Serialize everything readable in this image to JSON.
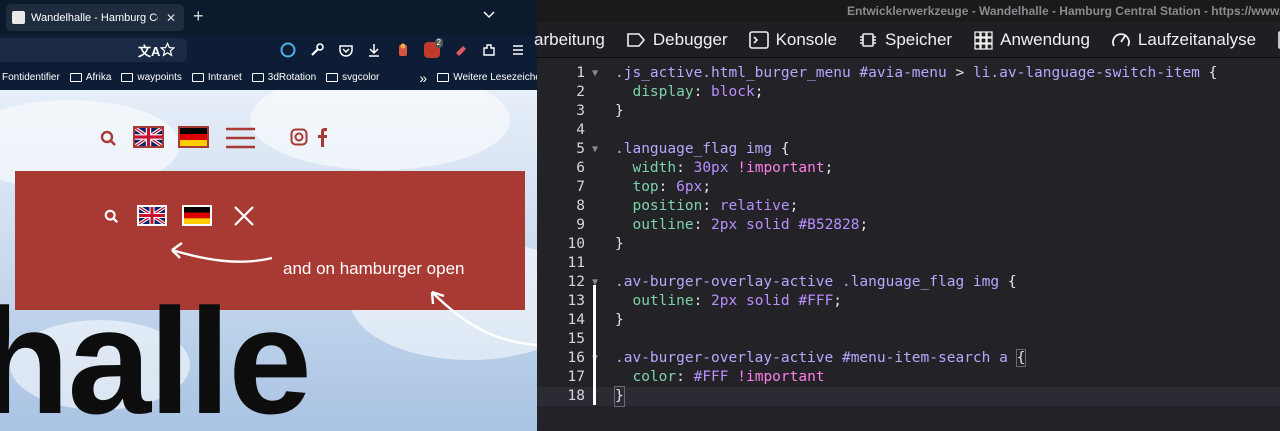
{
  "browser": {
    "tab_title": "Wandelhalle - Hamburg Central",
    "new_tab": "+",
    "bookmarks": [
      "Fontidentifier",
      "Afrika",
      "waypoints",
      "Intranet",
      "3dRotation",
      "svgcolor"
    ],
    "bookmarks_more": "»",
    "bookmarks_other": "Weitere Lesezeichen",
    "extension_badge": "2"
  },
  "webpage": {
    "hero_text": "halle",
    "annotation": "and on hamburger open"
  },
  "devtools": {
    "title": "Entwicklerwerkzeuge - Wandelhalle - Hamburg Central Station - https://www.wandel",
    "tabs": [
      "arbeitung",
      "Debugger",
      "Konsole",
      "Speicher",
      "Anwendung",
      "Laufzeitanalyse",
      "W"
    ],
    "lines": [
      {
        "n": "1",
        "fold": true,
        "text": ".js_active.html_burger_menu #avia-menu > li.av-language-switch-item {"
      },
      {
        "n": "2",
        "text": "  display: block;"
      },
      {
        "n": "3",
        "text": "}"
      },
      {
        "n": "4",
        "text": ""
      },
      {
        "n": "5",
        "fold": true,
        "text": ".language_flag img {"
      },
      {
        "n": "6",
        "text": "  width: 30px !important;"
      },
      {
        "n": "7",
        "text": "  top: 6px;"
      },
      {
        "n": "8",
        "text": "  position: relative;"
      },
      {
        "n": "9",
        "text": "  outline: 2px solid #B52828;"
      },
      {
        "n": "10",
        "text": "}"
      },
      {
        "n": "11",
        "text": ""
      },
      {
        "n": "12",
        "fold": true,
        "text": ".av-burger-overlay-active .language_flag img {"
      },
      {
        "n": "13",
        "text": "  outline: 2px solid #FFF;"
      },
      {
        "n": "14",
        "text": "}"
      },
      {
        "n": "15",
        "text": ""
      },
      {
        "n": "16",
        "fold": true,
        "text": ".av-burger-overlay-active #menu-item-search a {"
      },
      {
        "n": "17",
        "text": "  color: #FFF !important"
      },
      {
        "n": "18",
        "text": "}"
      }
    ]
  },
  "colors": {
    "accent_red": "#a83a33",
    "devtools_bg": "#232327"
  }
}
